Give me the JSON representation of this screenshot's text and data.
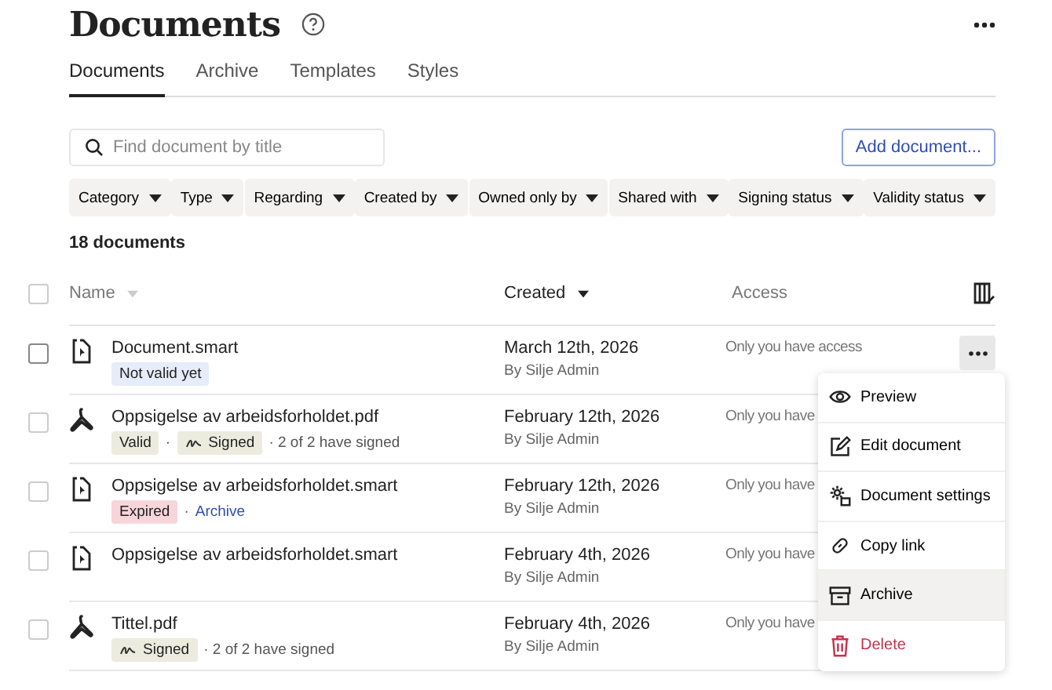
{
  "title": "Documents",
  "tabs": [
    {
      "label": "Documents",
      "selected": true
    },
    {
      "label": "Archive",
      "selected": false
    },
    {
      "label": "Templates",
      "selected": false
    },
    {
      "label": "Styles",
      "selected": false
    }
  ],
  "search": {
    "placeholder": "Find document by title"
  },
  "add_button": "Add document...",
  "filters": [
    "Category",
    "Type",
    "Regarding",
    "Created by",
    "Owned only by",
    "Shared with",
    "Signing status",
    "Validity status"
  ],
  "count": "18 documents",
  "select_all": {
    "checked": false
  },
  "columns": [
    {
      "label": "Name",
      "sorted": false
    },
    {
      "label": "Created",
      "sorted": true
    },
    {
      "label": "Access",
      "sorted": false
    }
  ],
  "rows": [
    {
      "kind": "smart",
      "name": "Document.smart",
      "checked": false,
      "hovered": true,
      "meta": [
        {
          "kind": "info-badge",
          "text": "Not valid yet"
        }
      ],
      "date": "March 12th, 2026",
      "by": "By Silje Admin",
      "access": "Only you have access"
    },
    {
      "kind": "pdf",
      "name": "Oppsigelse av arbeidsforholdet.pdf",
      "checked": false,
      "hovered": false,
      "meta": [
        {
          "kind": "ok-badge",
          "text": "Valid"
        },
        {
          "kind": "text",
          "text": "·"
        },
        {
          "kind": "signed",
          "text": "Signed"
        },
        {
          "kind": "text",
          "text": "· 2 of 2 have signed"
        }
      ],
      "date": "February 12th, 2026",
      "by": "By Silje Admin",
      "access": "Only you have"
    },
    {
      "kind": "smart",
      "name": "Oppsigelse av arbeidsforholdet.smart",
      "checked": false,
      "hovered": false,
      "meta": [
        {
          "kind": "danger-badge",
          "text": "Expired"
        },
        {
          "kind": "text",
          "text": "·"
        },
        {
          "kind": "link",
          "text": "Archive"
        }
      ],
      "date": "February 12th, 2026",
      "by": "By Silje Admin",
      "access": "Only you have"
    },
    {
      "kind": "smart",
      "name": "Oppsigelse av arbeidsforholdet.smart",
      "checked": false,
      "hovered": false,
      "meta": [],
      "date": "February 4th, 2026",
      "by": "By Silje Admin",
      "access": "Only you have"
    },
    {
      "kind": "pdf",
      "name": "Tittel.pdf",
      "checked": false,
      "hovered": false,
      "meta": [
        {
          "kind": "signed",
          "text": "Signed"
        },
        {
          "kind": "text",
          "text": "· 2 of 2 have signed"
        }
      ],
      "date": "February 4th, 2026",
      "by": "By Silje Admin",
      "access": "Only you have"
    }
  ],
  "menu": [
    {
      "kind": "eye",
      "label": "Preview",
      "selected": false
    },
    {
      "kind": "edit",
      "label": "Edit document",
      "selected": false
    },
    {
      "kind": "settings",
      "label": "Document settings",
      "selected": false
    },
    {
      "kind": "link",
      "label": "Copy link",
      "selected": false
    },
    {
      "kind": "archive",
      "label": "Archive",
      "selected": true
    },
    {
      "kind": "delete",
      "label": "Delete",
      "selected": false
    }
  ]
}
